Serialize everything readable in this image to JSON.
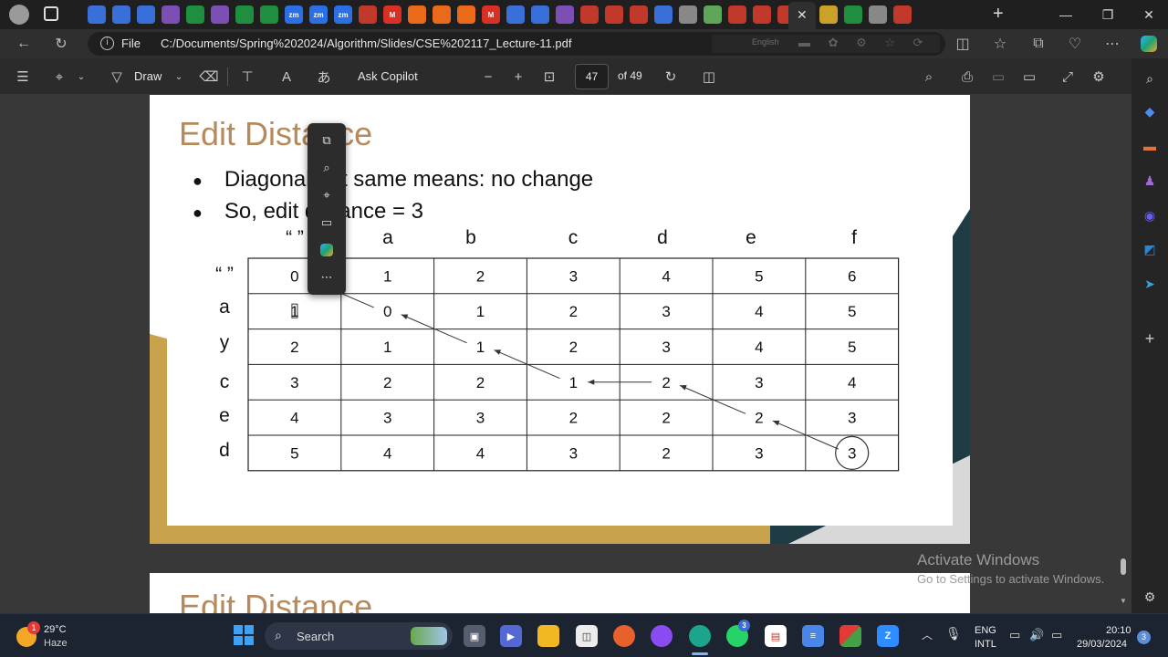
{
  "browser": {
    "url_scheme_label": "File",
    "url": "C:/Documents/Spring%202024/Algorithm/Slides/CSE%202117_Lecture-11.pdf",
    "translate_hint": "English",
    "tab_icon_colors": [
      "#3a6fd8",
      "#3a6fd8",
      "#3a6fd8",
      "#7b4fb3",
      "#1f8f3f",
      "#7b4fb3",
      "#1f8f3f",
      "#1f8f3f",
      "#2c6fe5",
      "#2c6fe5",
      "#2c6fe5",
      "#c0392b",
      "#d93025",
      "#e86a1a",
      "#e86a1a",
      "#e86a1a",
      "#d93025",
      "#3a6fd8",
      "#3a6fd8",
      "#7b4fb3",
      "#c0392b",
      "#c0392b",
      "#c0392b",
      "#3a6fd8",
      "#888888",
      "#5fa55a",
      "#c0392b",
      "#c0392b",
      "#c0392b",
      "#c9a227",
      "#1f8f3f",
      "#888888",
      "#c0392b"
    ],
    "tab_icon_labels": [
      "",
      "",
      "",
      "",
      "",
      "",
      "",
      "",
      "zm",
      "zm",
      "zm",
      "",
      "M",
      "",
      "",
      "",
      "M",
      "",
      "",
      "",
      "",
      "",
      "",
      "",
      "",
      "",
      "",
      "",
      "",
      "",
      "",
      "",
      ""
    ]
  },
  "pdf_toolbar": {
    "draw_label": "Draw",
    "copilot_label": "Ask Copilot",
    "page_current": "47",
    "page_total": "of 49"
  },
  "slide": {
    "title": "Edit Distance",
    "bullets": [
      "Diagonal but same means: no change",
      "So, edit distance = 3"
    ],
    "col_headers": [
      "“ ”",
      "a",
      "b",
      "c",
      "d",
      "e",
      "f"
    ],
    "row_headers": [
      "“ ”",
      "a",
      "y",
      "c",
      "e",
      "d"
    ],
    "grid": [
      [
        "0",
        "1",
        "2",
        "3",
        "4",
        "5",
        "6"
      ],
      [
        "1",
        "0",
        "1",
        "2",
        "3",
        "4",
        "5"
      ],
      [
        "2",
        "1",
        "1",
        "2",
        "3",
        "4",
        "5"
      ],
      [
        "3",
        "2",
        "2",
        "1",
        "2",
        "3",
        "4"
      ],
      [
        "4",
        "3",
        "3",
        "2",
        "2",
        "2",
        "3"
      ],
      [
        "5",
        "4",
        "4",
        "3",
        "2",
        "3",
        "3"
      ]
    ],
    "accent_color": "#b58a5c",
    "gold_color": "#c9a24e",
    "teal_color": "#1f3b44"
  },
  "next_slide_title": "Edit Distance",
  "watermark": {
    "line1": "Activate Windows",
    "line2": "Go to Settings to activate Windows."
  },
  "taskbar": {
    "weather_temp": "29°C",
    "weather_desc": "Haze",
    "weather_badge": "1",
    "search_label": "Search",
    "lang_line1": "ENG",
    "lang_line2": "INTL",
    "time": "20:10",
    "date": "29/03/2024",
    "notif_count": "3",
    "whatsapp_badge": "3"
  }
}
